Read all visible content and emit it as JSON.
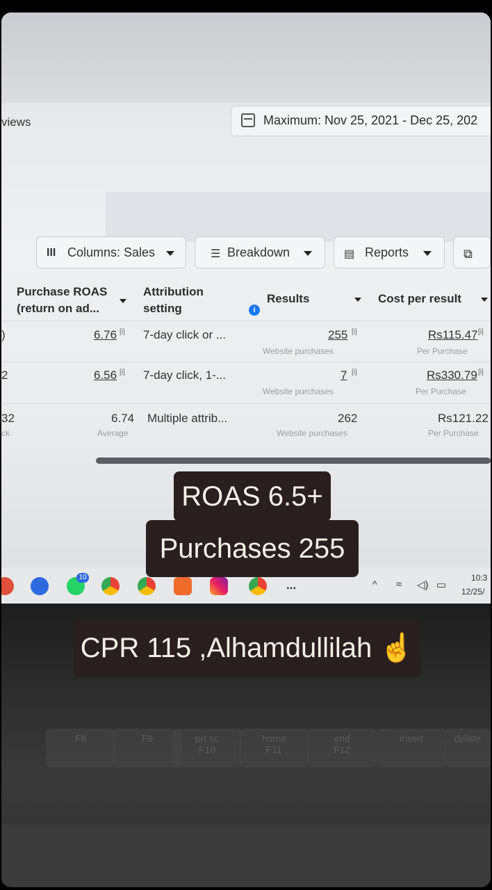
{
  "header": {
    "views_label": "views",
    "date_range": "Maximum: Nov 25, 2021 - Dec 25, 202"
  },
  "toolbar": {
    "columns": "Columns: Sales",
    "breakdown": "Breakdown",
    "reports": "Reports"
  },
  "table": {
    "headers": {
      "roas_line1": "Purchase ROAS",
      "roas_line2": "(return on ad...",
      "attr_line1": "Attribution",
      "attr_line2": "setting",
      "results": "Results",
      "cost": "Cost per result"
    },
    "rows": [
      {
        "left": ")",
        "roas": "6.76",
        "attr": "7-day click or ...",
        "results": "255",
        "results_sub": "Website purchases",
        "cost": "Rs115.47",
        "cost_sub": "Per Purchase"
      },
      {
        "left": "2",
        "roas": "6.56",
        "attr": "7-day click, 1-...",
        "results": "7",
        "results_sub": "Website purchases",
        "cost": "Rs330.79",
        "cost_sub": "Per Purchase"
      }
    ],
    "total": {
      "left": "32",
      "left_sub": "ck",
      "roas": "6.74",
      "roas_sub": "Average",
      "attr": "Multiple attrib...",
      "results": "262",
      "results_sub": "Website purchases",
      "cost": "Rs121.22",
      "cost_sub": "Per Purchase"
    }
  },
  "taskbar": {
    "whatsapp_badge": "10",
    "more": "...",
    "time": "10:3",
    "date": "12/25/"
  },
  "keyboard": [
    "prt sc",
    "home",
    "end",
    "insert",
    "delete"
  ],
  "keyboard_fn": [
    "F8",
    "F9",
    "F10",
    "F11",
    "F12"
  ],
  "captions": {
    "line1": "ROAS 6.5+",
    "line2": "Purchases 255",
    "line3": "CPR 115 ,Alhamdullilah ☝️"
  },
  "colors": {
    "caption_bg": "#2a1f1f",
    "accent_blue": "#1877f2"
  }
}
